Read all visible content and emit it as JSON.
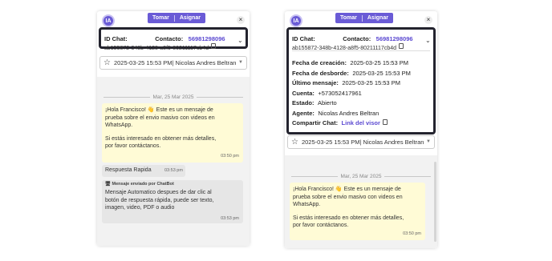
{
  "header": {
    "avatar_label": "IA",
    "take_label": "Tomar",
    "assign_label": "Asignar",
    "close_icon": "×"
  },
  "info": {
    "id_chat_label": "ID Chat:",
    "contact_label": "Contacto:",
    "contact_value": "56981298096",
    "chat_id": "ab155872-348b-4128-a8f5-80211117cb4d",
    "creation_label": "Fecha de creación:",
    "creation_value": "2025-03-25 15:53 PM",
    "overflow_label": "Fecha de desborde:",
    "overflow_value": "2025-03-25 15:53 PM",
    "last_msg_label": "Último mensaje:",
    "last_msg_value": "2025-03-25 15:53 PM",
    "account_label": "Cuenta:",
    "account_value": "+573052417961",
    "state_label": "Estado:",
    "state_value": "Abierto",
    "agent_label": "Agente:",
    "agent_value": "Nicolas Andres Beltran",
    "share_label": "Compartir Chat:",
    "share_link": "Link del visor"
  },
  "selector": {
    "value": "2025-03-25 15:53 PM| Nicolas Andres Beltran"
  },
  "chat": {
    "date": "Mar, 25 Mar 2025",
    "msg1": {
      "line1": "¡Hola Francisco! 👋 Este es un mensaje de",
      "line2": "prueba sobre el envio masivo con videos en",
      "line3": "WhatsApp.",
      "line4": "Si estás interesado en obtener más detalles,",
      "line5": "por favor contáctanos.",
      "time": "03:50 pm"
    },
    "quick_reply": {
      "label": "Respuesta Rapida",
      "time": "03:53 pm"
    },
    "bot_msg": {
      "header": "Mensaje enviado por ChatBot",
      "line1": "Mensaje Automatico despues de dar clic al",
      "line2": "botón de respuesta rápida, puede ser texto,",
      "line3": "imagen, video, PDF o audio",
      "time": "03:53 pm"
    }
  }
}
